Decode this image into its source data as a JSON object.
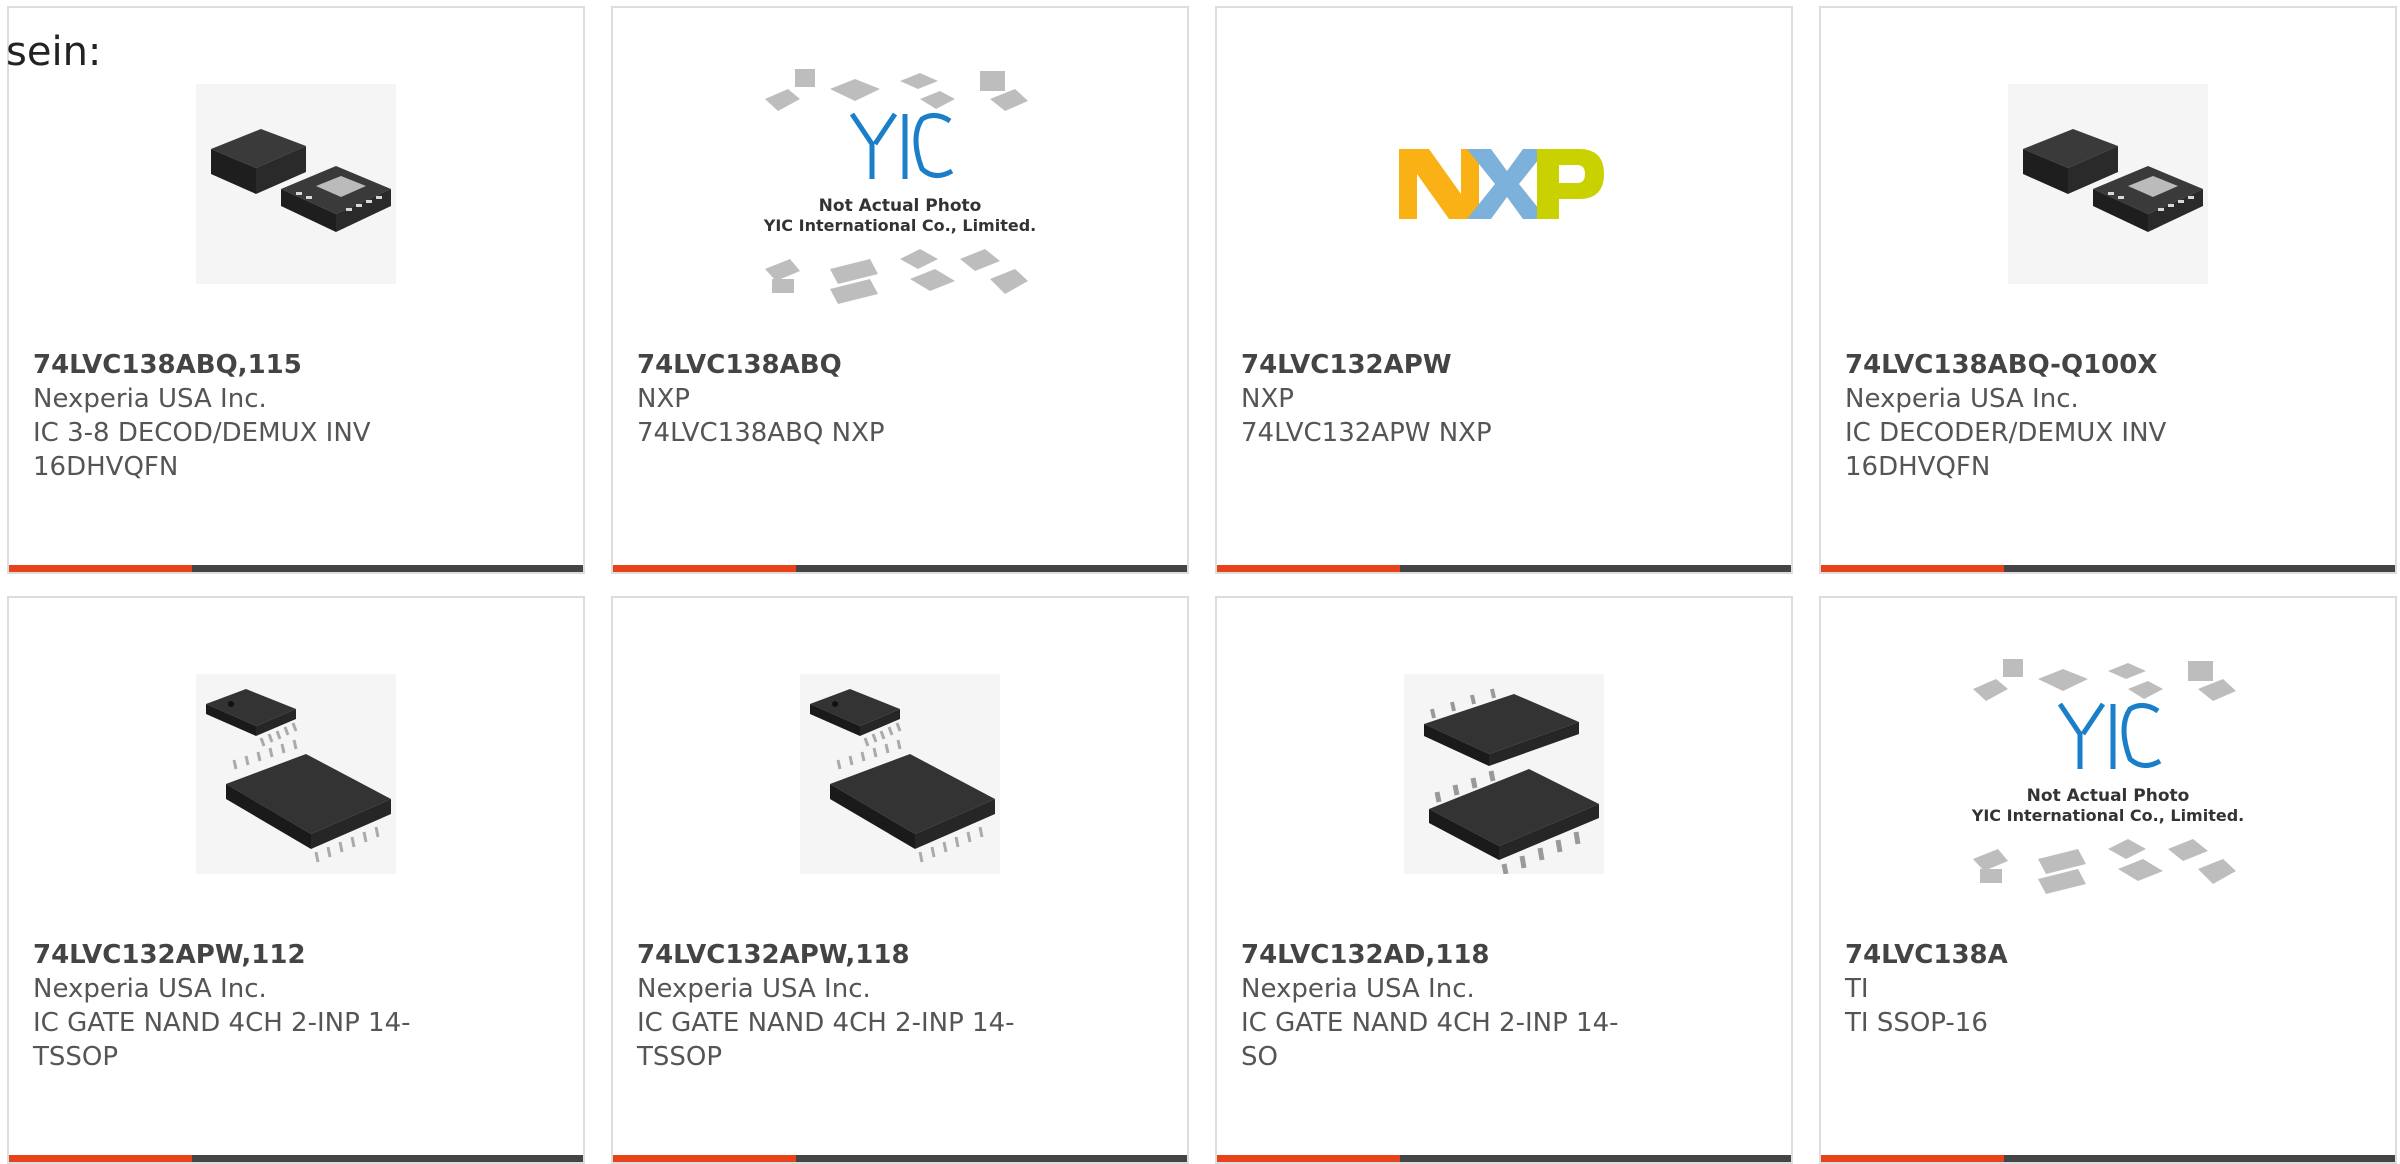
{
  "intro_text": "sein:",
  "accent_color": "#e8421a",
  "bar_color": "#444444",
  "yic_placeholder": {
    "line1": "Not Actual Photo",
    "line2": "YIC International Co., Limited."
  },
  "products": [
    {
      "part_number": "74LVC138ABQ,115",
      "manufacturer": "Nexperia USA Inc.",
      "description": "IC 3-8 DECOD/DEMUX INV 16DHVQFN",
      "image_type": "dhvqfn-chip-photo"
    },
    {
      "part_number": "74LVC138ABQ",
      "manufacturer": "NXP",
      "description": "74LVC138ABQ NXP",
      "image_type": "yic-placeholder"
    },
    {
      "part_number": "74LVC132APW",
      "manufacturer": "NXP",
      "description": "74LVC132APW NXP",
      "image_type": "nxp-logo"
    },
    {
      "part_number": "74LVC138ABQ-Q100X",
      "manufacturer": "Nexperia USA Inc.",
      "description": "IC DECODER/DEMUX INV 16DHVQFN",
      "image_type": "dhvqfn-chip-photo"
    },
    {
      "part_number": "74LVC132APW,112",
      "manufacturer": "Nexperia USA Inc.",
      "description": "IC GATE NAND 4CH 2-INP 14-TSSOP",
      "image_type": "tssop-chip-photo"
    },
    {
      "part_number": "74LVC132APW,118",
      "manufacturer": "Nexperia USA Inc.",
      "description": "IC GATE NAND 4CH 2-INP 14-TSSOP",
      "image_type": "tssop-chip-photo"
    },
    {
      "part_number": "74LVC132AD,118",
      "manufacturer": "Nexperia USA Inc.",
      "description": "IC GATE NAND 4CH 2-INP 14-SO",
      "image_type": "so-chip-photo"
    },
    {
      "part_number": "74LVC138A",
      "manufacturer": "TI",
      "description": "TI SSOP-16",
      "image_type": "yic-placeholder"
    }
  ],
  "nxp_logo": {
    "text": "NXP",
    "colors": [
      "#f9b115",
      "#7bb1db",
      "#c9d200"
    ]
  }
}
